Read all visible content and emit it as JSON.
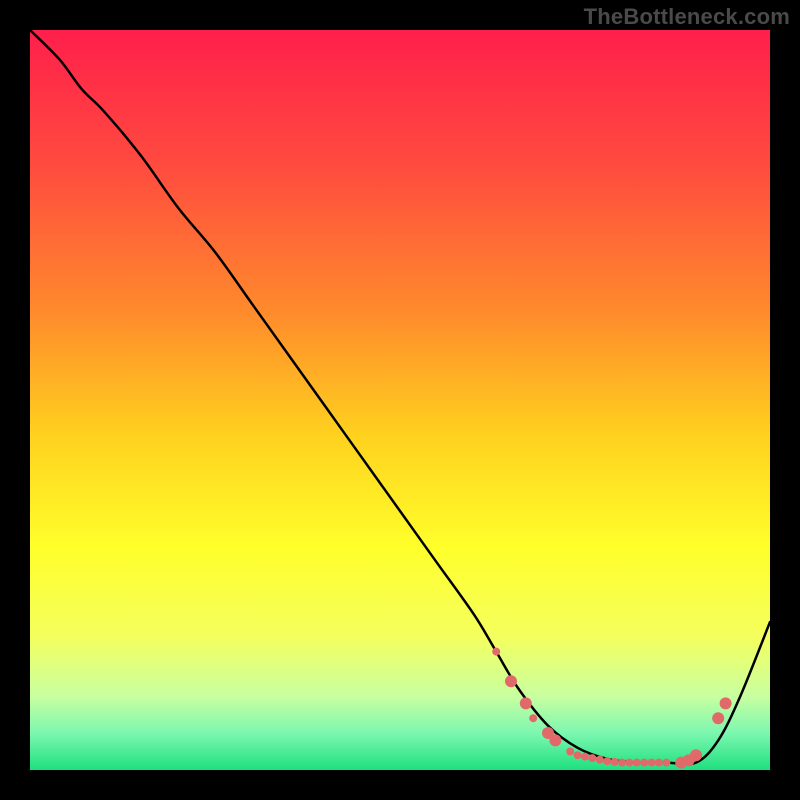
{
  "watermark": "TheBottleneck.com",
  "chart_data": {
    "type": "line",
    "title": "",
    "xlabel": "",
    "ylabel": "",
    "xlim": [
      0,
      100
    ],
    "ylim": [
      0,
      100
    ],
    "gradient_stops": [
      {
        "offset": 0,
        "color": "#ff1f4b"
      },
      {
        "offset": 18,
        "color": "#ff4a3f"
      },
      {
        "offset": 38,
        "color": "#ff8a2c"
      },
      {
        "offset": 55,
        "color": "#ffd21e"
      },
      {
        "offset": 70,
        "color": "#ffff2b"
      },
      {
        "offset": 82,
        "color": "#f4ff5e"
      },
      {
        "offset": 90,
        "color": "#c9ffa0"
      },
      {
        "offset": 95,
        "color": "#7cf7b0"
      },
      {
        "offset": 100,
        "color": "#1ee07e"
      }
    ],
    "series": [
      {
        "name": "bottleneck-curve",
        "x": [
          0,
          4,
          7,
          10,
          15,
          20,
          25,
          30,
          35,
          40,
          45,
          50,
          55,
          60,
          63,
          66,
          70,
          74,
          78,
          82,
          86,
          90,
          93,
          96,
          100
        ],
        "y": [
          100,
          96,
          92,
          89,
          83,
          76,
          70,
          63,
          56,
          49,
          42,
          35,
          28,
          21,
          16,
          11,
          6,
          3,
          1.5,
          1,
          1,
          1,
          4,
          10,
          20
        ]
      }
    ],
    "markers": {
      "name": "highlight-dots",
      "color": "#e06a6a",
      "radius_small": 4,
      "radius_large": 6,
      "points": [
        {
          "x": 63,
          "y": 16,
          "r": "small"
        },
        {
          "x": 65,
          "y": 12,
          "r": "large"
        },
        {
          "x": 67,
          "y": 9,
          "r": "large"
        },
        {
          "x": 68,
          "y": 7,
          "r": "small"
        },
        {
          "x": 70,
          "y": 5,
          "r": "large"
        },
        {
          "x": 71,
          "y": 4,
          "r": "large"
        },
        {
          "x": 73,
          "y": 2.5,
          "r": "small"
        },
        {
          "x": 74,
          "y": 2,
          "r": "small"
        },
        {
          "x": 75,
          "y": 1.8,
          "r": "small"
        },
        {
          "x": 76,
          "y": 1.6,
          "r": "small"
        },
        {
          "x": 77,
          "y": 1.4,
          "r": "small"
        },
        {
          "x": 78,
          "y": 1.2,
          "r": "small"
        },
        {
          "x": 79,
          "y": 1.1,
          "r": "small"
        },
        {
          "x": 80,
          "y": 1.0,
          "r": "small"
        },
        {
          "x": 81,
          "y": 1.0,
          "r": "small"
        },
        {
          "x": 82,
          "y": 1.0,
          "r": "small"
        },
        {
          "x": 83,
          "y": 1.0,
          "r": "small"
        },
        {
          "x": 84,
          "y": 1.0,
          "r": "small"
        },
        {
          "x": 85,
          "y": 1.0,
          "r": "small"
        },
        {
          "x": 86,
          "y": 1.0,
          "r": "small"
        },
        {
          "x": 88,
          "y": 1.0,
          "r": "large"
        },
        {
          "x": 89,
          "y": 1.3,
          "r": "large"
        },
        {
          "x": 90,
          "y": 2,
          "r": "large"
        },
        {
          "x": 93,
          "y": 7,
          "r": "large"
        },
        {
          "x": 94,
          "y": 9,
          "r": "large"
        }
      ]
    }
  }
}
